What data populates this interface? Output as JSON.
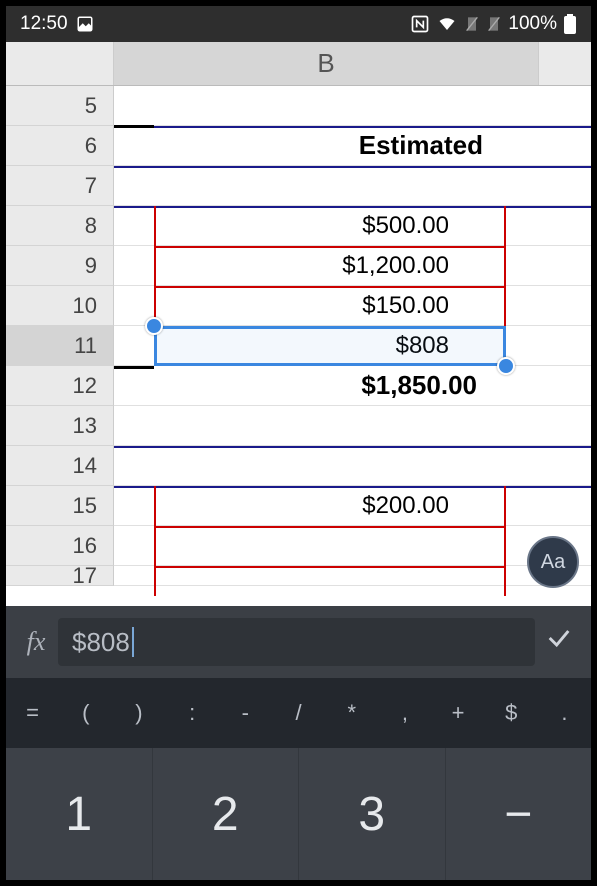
{
  "status": {
    "time": "12:50",
    "battery": "100%"
  },
  "column_label": "B",
  "rows": [
    {
      "n": "5",
      "text": ""
    },
    {
      "n": "6",
      "text": "Estimated",
      "bold": true,
      "big": true
    },
    {
      "n": "7",
      "text": ""
    },
    {
      "n": "8",
      "text": "$500.00"
    },
    {
      "n": "9",
      "text": "$1,200.00"
    },
    {
      "n": "10",
      "text": "$150.00"
    },
    {
      "n": "11",
      "text": "$808",
      "selected": true
    },
    {
      "n": "12",
      "text": "$1,850.00",
      "bold": true,
      "big": true
    },
    {
      "n": "13",
      "text": ""
    },
    {
      "n": "14",
      "text": ""
    },
    {
      "n": "15",
      "text": "$200.00"
    },
    {
      "n": "16",
      "text": ""
    },
    {
      "n": "17",
      "text": ""
    }
  ],
  "fab_label": "Aa",
  "formula": {
    "fx": "fx",
    "value": "$808",
    "confirm_glyph": "✓"
  },
  "symbols": [
    "=",
    "(",
    ")",
    ":",
    "-",
    "/",
    "*",
    ",",
    "+",
    "$",
    "."
  ],
  "numpad": [
    "1",
    "2",
    "3",
    "−"
  ]
}
